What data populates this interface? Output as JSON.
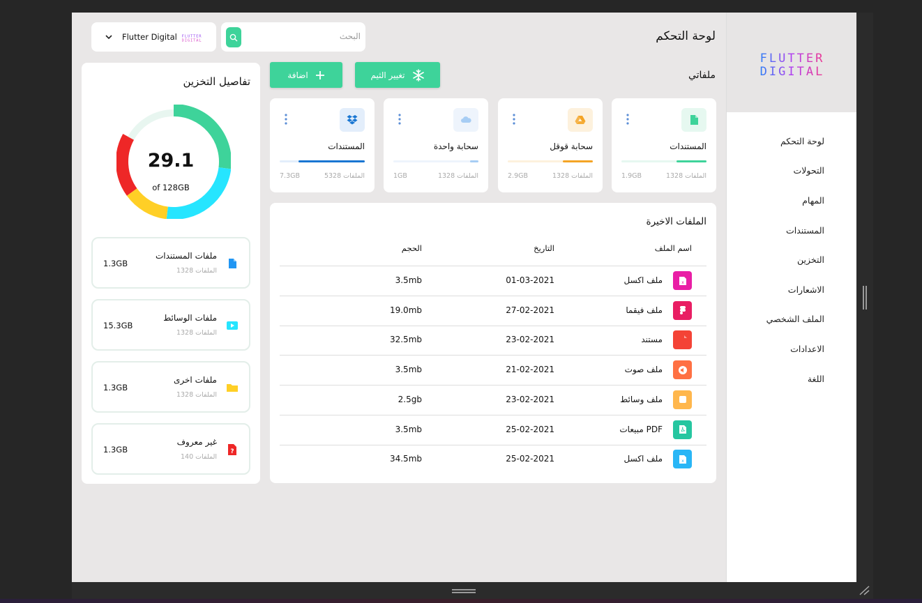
{
  "sidebar": {
    "logo_text": "FLUTTER DIGITAL",
    "items": [
      {
        "label": "لوحة التحكم"
      },
      {
        "label": "التحولات"
      },
      {
        "label": "المهام"
      },
      {
        "label": "المستندات"
      },
      {
        "label": "التخزين"
      },
      {
        "label": "الاشعارات"
      },
      {
        "label": "الملف الشخصي"
      },
      {
        "label": "الاعدادات"
      },
      {
        "label": "اللغة"
      }
    ]
  },
  "header": {
    "title": "لوحة التحكم",
    "search_placeholder": "البحث",
    "profile_name": "Flutter Digital",
    "mini_logo_text": "FLUTTER DIGITAL"
  },
  "my_files": {
    "title": "ملفاتي",
    "theme_button": "تغيير الثيم",
    "add_button": "اضافة",
    "cards": [
      {
        "title": "المستندات",
        "count": "1328 الملفات",
        "size": "1.9GB",
        "icon": "document-icon",
        "color": "#3ed39a",
        "bg": "#e6f8f0",
        "progress": 0.35
      },
      {
        "title": "سحابة قوقل",
        "count": "1328 الملفات",
        "size": "2.9GB",
        "icon": "google-drive-icon",
        "color": "#f4a425",
        "bg": "#fdf1dd",
        "progress": 0.35
      },
      {
        "title": "سحابة واحدة",
        "count": "1328 الملفات",
        "size": "1GB",
        "icon": "onedrive-icon",
        "color": "#a7cdf4",
        "bg": "#eef4fc",
        "progress": 0.1
      },
      {
        "title": "المستندات",
        "count": "5328 الملفات",
        "size": "7.3GB",
        "icon": "dropbox-icon",
        "color": "#1976d2",
        "bg": "#e3eefb",
        "progress": 0.78
      }
    ]
  },
  "recent": {
    "title": "الملفات الاخيرة",
    "columns": {
      "name": "اسم الملف",
      "date": "التاريخ",
      "size": "الحجم"
    },
    "rows": [
      {
        "name": "ملف اكسل",
        "date": "01-03-2021",
        "size": "3.5mb",
        "icon": "excel-icon",
        "color": "#e91ea5"
      },
      {
        "name": "ملف فيقما",
        "date": "27-02-2021",
        "size": "19.0mb",
        "icon": "figma-icon",
        "color": "#e91e63"
      },
      {
        "name": "مستند",
        "date": "23-02-2021",
        "size": "32.5mb",
        "icon": "document-icon",
        "color": "#f44336"
      },
      {
        "name": "ملف صوت",
        "date": "21-02-2021",
        "size": "3.5mb",
        "icon": "audio-icon",
        "color": "#ff7043"
      },
      {
        "name": "ملف وسائط",
        "date": "23-02-2021",
        "size": "2.5gb",
        "icon": "media-icon",
        "color": "#ffb74d"
      },
      {
        "name": "مبيعات PDF",
        "date": "25-02-2021",
        "size": "3.5mb",
        "icon": "pdf-icon",
        "color": "#26c6a0"
      },
      {
        "name": "ملف اكسل",
        "date": "25-02-2021",
        "size": "34.5mb",
        "icon": "excel-icon",
        "color": "#29b6f6"
      }
    ]
  },
  "storage": {
    "title": "تفاصيل التخزين",
    "used": "29.1",
    "total": "of 128GB",
    "ring": [
      {
        "color": "#3ed39a",
        "fraction": 0.27
      },
      {
        "color": "#26e5ff",
        "fraction": 0.25
      },
      {
        "color": "#ffcf26",
        "fraction": 0.13
      },
      {
        "color": "#ee2727",
        "fraction": 0.18
      },
      {
        "color": "#e8f6f0",
        "fraction": 0.17
      }
    ],
    "items": [
      {
        "title": "ملفات المستندات",
        "count": "1328 الملفات",
        "size": "1.3GB",
        "icon": "document-icon",
        "color": "#2196f3"
      },
      {
        "title": "ملفات الوسائط",
        "count": "1328 الملفات",
        "size": "15.3GB",
        "icon": "video-icon",
        "color": "#26e5ff"
      },
      {
        "title": "ملفات اخرى",
        "count": "1328 الملفات",
        "size": "1.3GB",
        "icon": "folder-icon",
        "color": "#ffcf26"
      },
      {
        "title": "غير معروف",
        "count": "140 الملفات",
        "size": "1.3GB",
        "icon": "unknown-file-icon",
        "color": "#ee2727"
      }
    ]
  }
}
